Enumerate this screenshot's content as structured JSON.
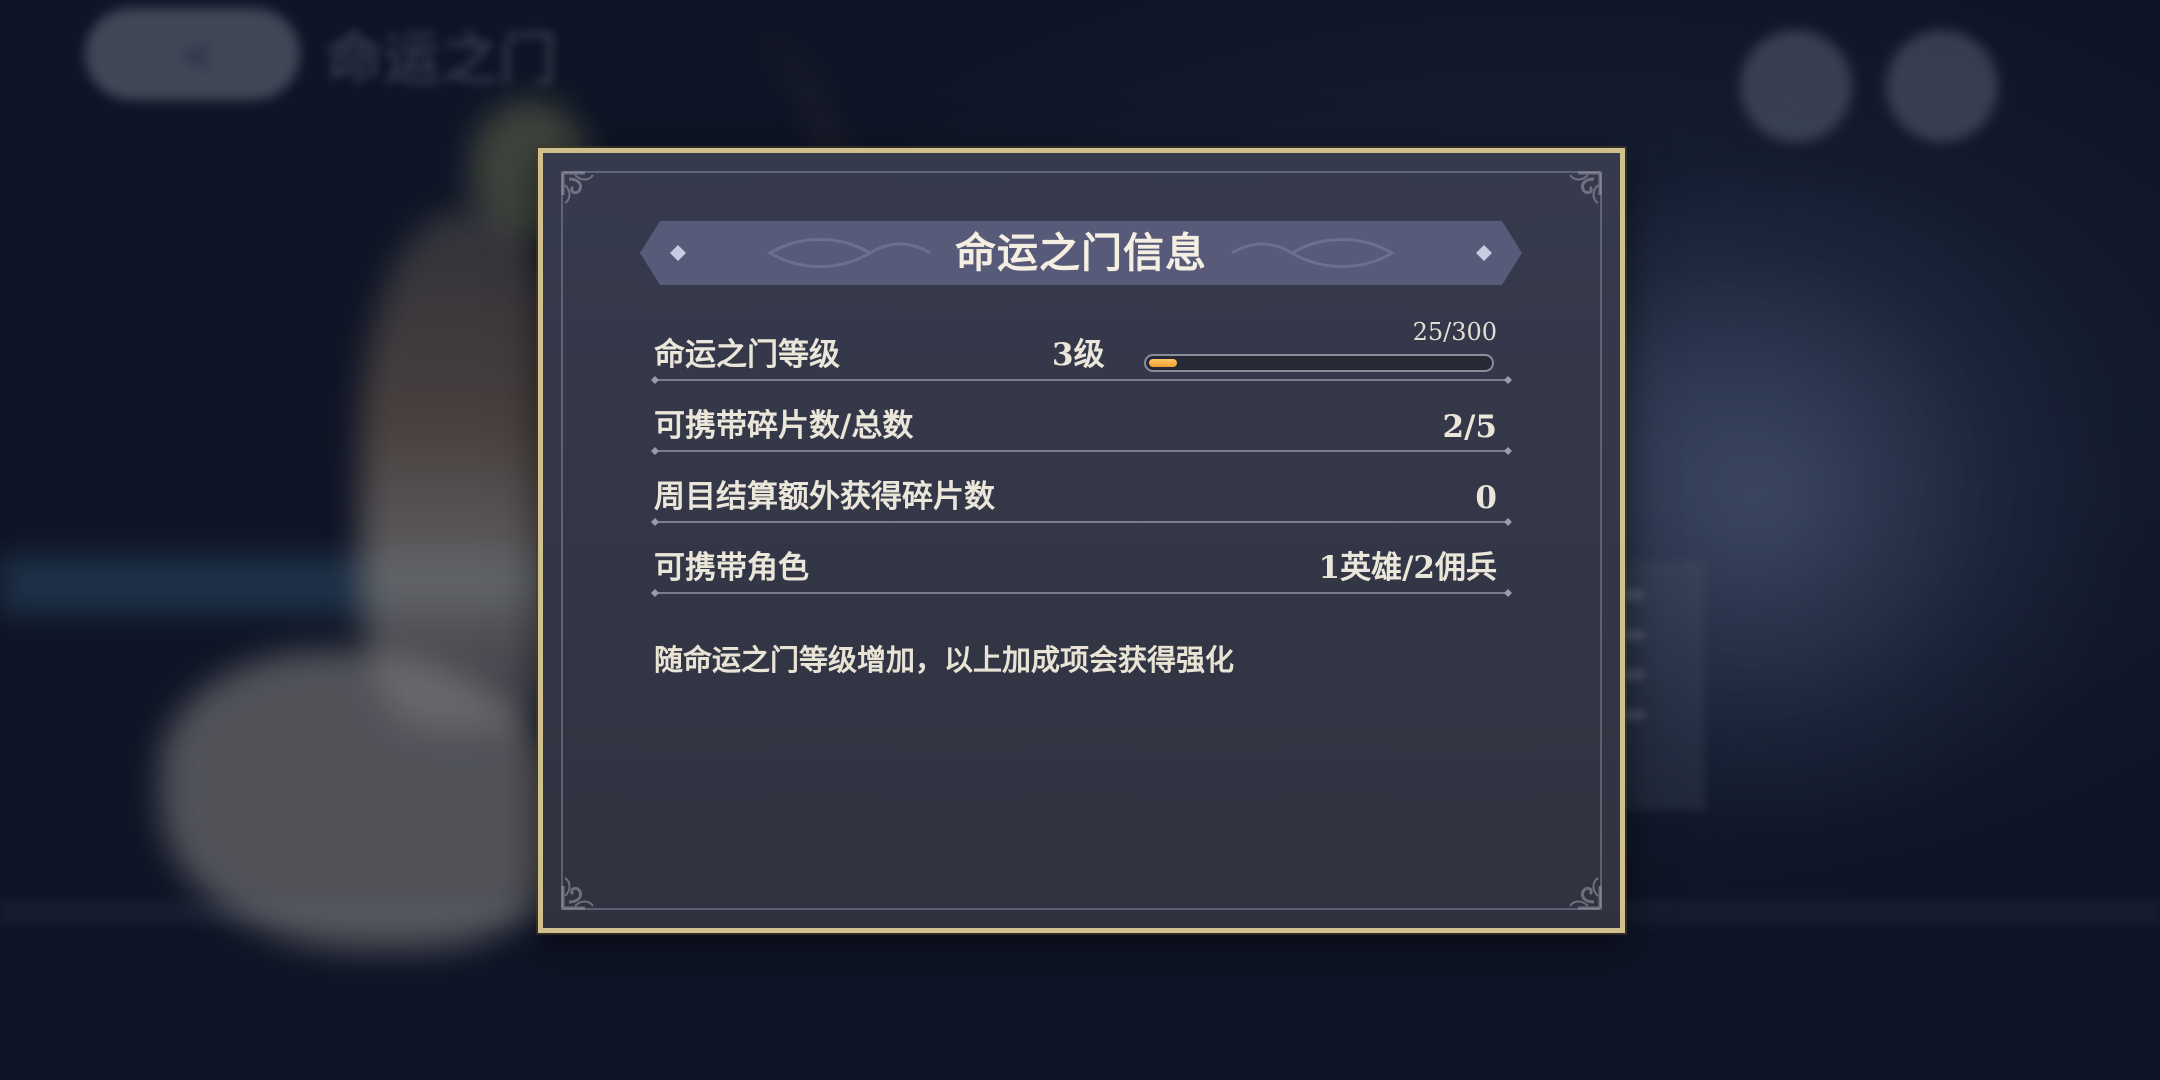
{
  "background": {
    "hud_title": "命运之门",
    "hud_buttons": [
      {
        "icon": "gear-icon",
        "label": ""
      },
      {
        "icon": "menu-icon",
        "label": ""
      }
    ]
  },
  "modal": {
    "title": "命运之门信息",
    "rows": [
      {
        "label": "命运之门等级",
        "value": "3级",
        "progress_text": "25/300",
        "progress": 0.083
      },
      {
        "label": "可携带碎片数/总数",
        "value": "2/5"
      },
      {
        "label": "周目结算额外获得碎片数",
        "value": "0"
      },
      {
        "label": "可携带角色",
        "value": "1英雄/2佣兵"
      }
    ],
    "note": "随命运之门等级增加，以上加成项会获得强化"
  },
  "colors": {
    "frame_gold": "#cfc08e",
    "panel_bg": "#30333f",
    "banner_bg": "#575a78",
    "progress_fill": "#f0a030",
    "text": "#ebe6da"
  }
}
